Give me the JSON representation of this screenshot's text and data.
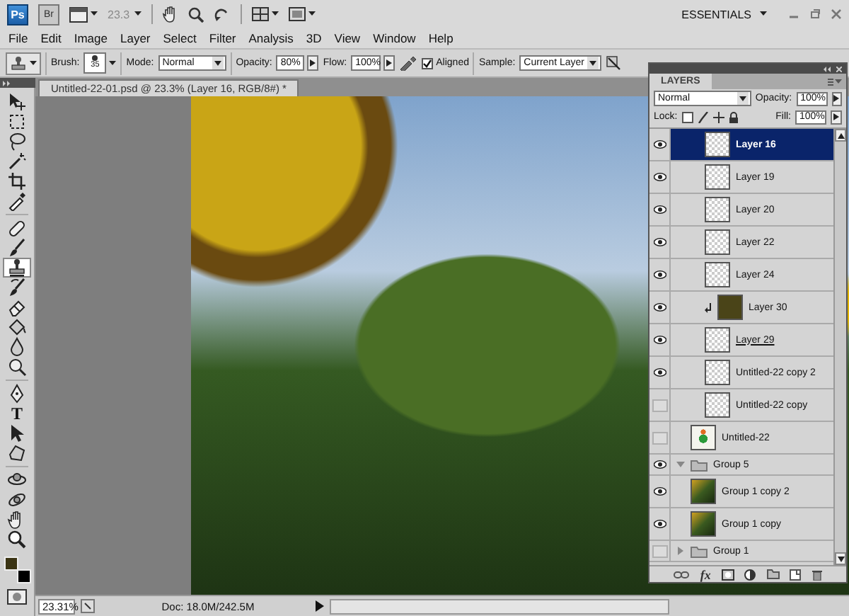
{
  "app_bar": {
    "logo": "Ps",
    "bridge": "Br",
    "zoom": "23.3",
    "workspace": "ESSENTIALS"
  },
  "menu": [
    "File",
    "Edit",
    "Image",
    "Layer",
    "Select",
    "Filter",
    "Analysis",
    "3D",
    "View",
    "Window",
    "Help"
  ],
  "options": {
    "brush_label": "Brush:",
    "brush_size": "35",
    "mode_label": "Mode:",
    "mode": "Normal",
    "opacity_label": "Opacity:",
    "opacity": "80%",
    "flow_label": "Flow:",
    "flow": "100%",
    "aligned": {
      "label": "Aligned",
      "checked": true
    },
    "sample_label": "Sample:",
    "sample": "Current Layer"
  },
  "tools": [
    {
      "kind": "move",
      "selected": false
    },
    {
      "kind": "marquee",
      "selected": false
    },
    {
      "kind": "lasso",
      "selected": false
    },
    {
      "kind": "wand",
      "selected": false
    },
    {
      "kind": "crop",
      "selected": false
    },
    {
      "kind": "eyedropper",
      "selected": false
    },
    {
      "kind": "healing",
      "selected": false
    },
    {
      "kind": "brush",
      "selected": false
    },
    {
      "kind": "stamp",
      "selected": true
    },
    {
      "kind": "history",
      "selected": false
    },
    {
      "kind": "eraser",
      "selected": false
    },
    {
      "kind": "bucket",
      "selected": false
    },
    {
      "kind": "blur",
      "selected": false
    },
    {
      "kind": "dodge",
      "selected": false
    },
    {
      "kind": "pen",
      "selected": false
    },
    {
      "kind": "type",
      "glyph": "T",
      "selected": false
    },
    {
      "kind": "path",
      "selected": false
    },
    {
      "kind": "shape",
      "selected": false
    },
    {
      "kind": "rotate3d",
      "selected": false
    },
    {
      "kind": "orbit3d",
      "selected": false
    },
    {
      "kind": "hand",
      "selected": false
    },
    {
      "kind": "zoom",
      "selected": false
    }
  ],
  "document": {
    "tab_title": "Untitled-22-01.psd @ 23.3% (Layer 16, RGB/8#) *"
  },
  "status_bar": {
    "zoom": "23.31%",
    "info": "Doc: 18.0M/242.5M"
  },
  "layers_panel": {
    "title": "LAYERS",
    "blend_mode": "Normal",
    "opacity_label": "Opacity:",
    "opacity": "100%",
    "lock_label": "Lock:",
    "fill_label": "Fill:",
    "fill": "100%",
    "fx_label": "fx",
    "layers": [
      {
        "kind": "container",
        "children": [
          {
            "kind": "container",
            "children": [
              {
                "kind": "layer",
                "name": "Layer 16",
                "visible": true,
                "selected": true
              },
              {
                "kind": "layer",
                "name": "Layer 19",
                "visible": true,
                "selected": false
              },
              {
                "kind": "layer",
                "name": "Layer 20",
                "visible": true,
                "selected": false
              },
              {
                "kind": "layer",
                "name": "Layer 22",
                "visible": true,
                "selected": false
              },
              {
                "kind": "layer",
                "name": "Layer 24",
                "visible": true,
                "selected": false
              },
              {
                "kind": "fill",
                "name": "Layer 30",
                "color": "#4a4418",
                "clipped": true,
                "visible": true,
                "selected": false
              },
              {
                "kind": "layer",
                "name": "Layer 29",
                "clip_base": true,
                "visible": true,
                "selected": false
              },
              {
                "kind": "layer",
                "name": "Untitled-22 copy 2",
                "visible": true,
                "selected": false
              },
              {
                "kind": "layer",
                "name": "Untitled-22 copy",
                "visible": false,
                "selected": false
              }
            ]
          },
          {
            "kind": "artwork",
            "name": "Untitled-22",
            "visible": false,
            "selected": false
          }
        ]
      },
      {
        "kind": "group",
        "name": "Group 5",
        "expanded": true,
        "visible": true,
        "selected": false,
        "children": [
          {
            "kind": "photo",
            "name": "Group 1 copy 2",
            "visible": true,
            "selected": false
          },
          {
            "kind": "photo",
            "name": "Group 1 copy",
            "visible": true,
            "selected": false
          }
        ]
      },
      {
        "kind": "group",
        "name": "Group 1",
        "expanded": false,
        "visible": false,
        "selected": false
      }
    ]
  }
}
